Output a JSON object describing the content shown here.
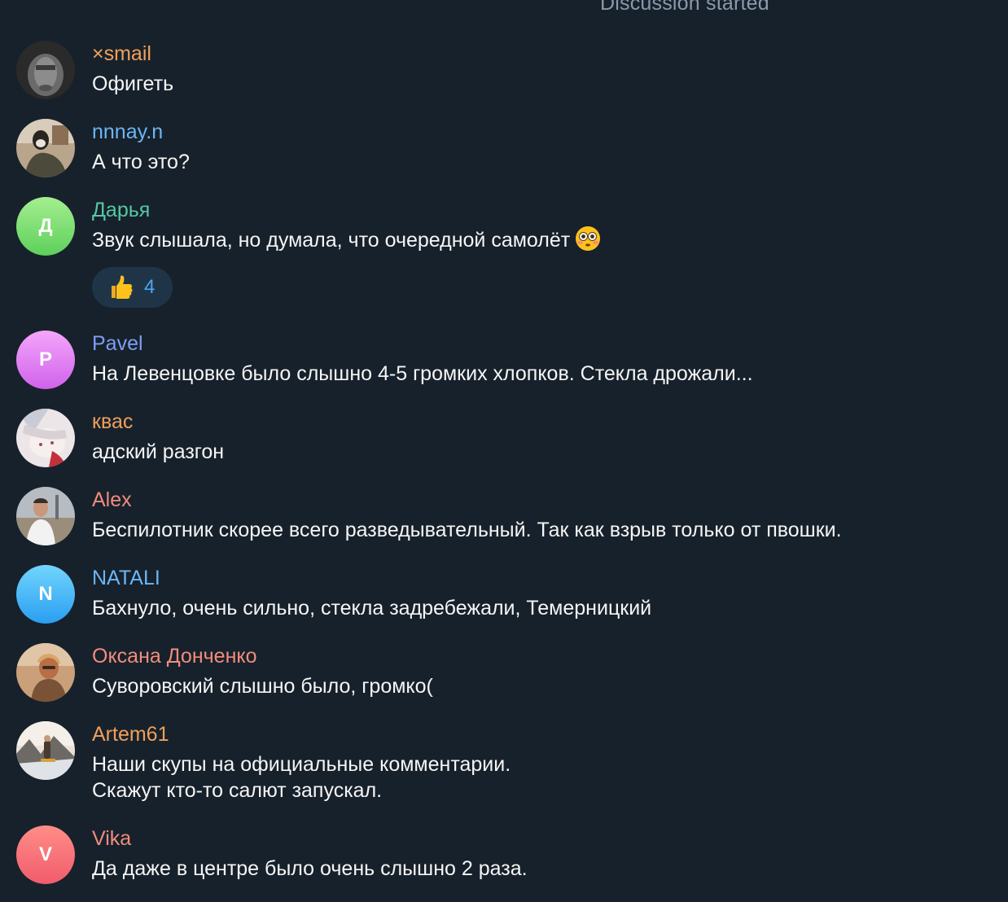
{
  "service_message": "Discussion started",
  "colors": {
    "background": "#17212b",
    "text": "#f5f5f5",
    "reaction_bg": "#1f3547",
    "reaction_count": "#4ea4f6"
  },
  "messages": [
    {
      "author": "×smail",
      "author_color": "#f0a05a",
      "avatar": "photo",
      "lines": [
        "Офигеть"
      ]
    },
    {
      "author": "nnnay.n",
      "author_color": "#6cb6f5",
      "avatar": "photo",
      "lines": [
        "А что это?"
      ]
    },
    {
      "author": "Дарья",
      "author_color": "#55c8a4",
      "avatar": "initial",
      "initial": "Д",
      "avatar_colors": [
        "#a5ee8f",
        "#5cd05b"
      ],
      "lines": [
        "Звук слышала, но думала, что очередной самолёт"
      ],
      "emoji": "flushed-face-emoji",
      "reaction": {
        "emoji": "thumbs-up-emoji",
        "count": "4"
      }
    },
    {
      "author": "Pavel",
      "author_color": "#7d9ef6",
      "avatar": "initial",
      "initial": "P",
      "avatar_colors": [
        "#f4a6fa",
        "#d062eb"
      ],
      "lines": [
        "На Левенцовке было слышно 4-5 громких хлопков. Стекла дрожали..."
      ]
    },
    {
      "author": "квас",
      "author_color": "#f0a05a",
      "avatar": "photo",
      "lines": [
        "адский разгон"
      ]
    },
    {
      "author": "Alex",
      "author_color": "#f08c7e",
      "avatar": "photo",
      "lines": [
        "Беспилотник скорее всего разведывательный. Так как взрыв только от пвошки."
      ]
    },
    {
      "author": "NATALI",
      "author_color": "#6cb6f5",
      "avatar": "initial",
      "initial": "N",
      "avatar_colors": [
        "#72d5fd",
        "#2a9ef1"
      ],
      "lines": [
        "Бахнуло, очень сильно, стекла задребежали, Темерницкий"
      ]
    },
    {
      "author": "Оксана Донченко",
      "author_color": "#f08c7e",
      "avatar": "photo",
      "lines": [
        "Суворовский слышно было, громко("
      ]
    },
    {
      "author": "Artem61",
      "author_color": "#f0a05a",
      "avatar": "photo",
      "lines": [
        "Наши скупы на официальные комментарии.",
        "Скажут кто-то салют запускал."
      ]
    },
    {
      "author": "Vika",
      "author_color": "#f08c7e",
      "avatar": "initial",
      "initial": "V",
      "avatar_colors": [
        "#ff8d87",
        "#f15c6c"
      ],
      "lines": [
        "Да даже в центре было очень слышно 2 раза."
      ]
    }
  ]
}
